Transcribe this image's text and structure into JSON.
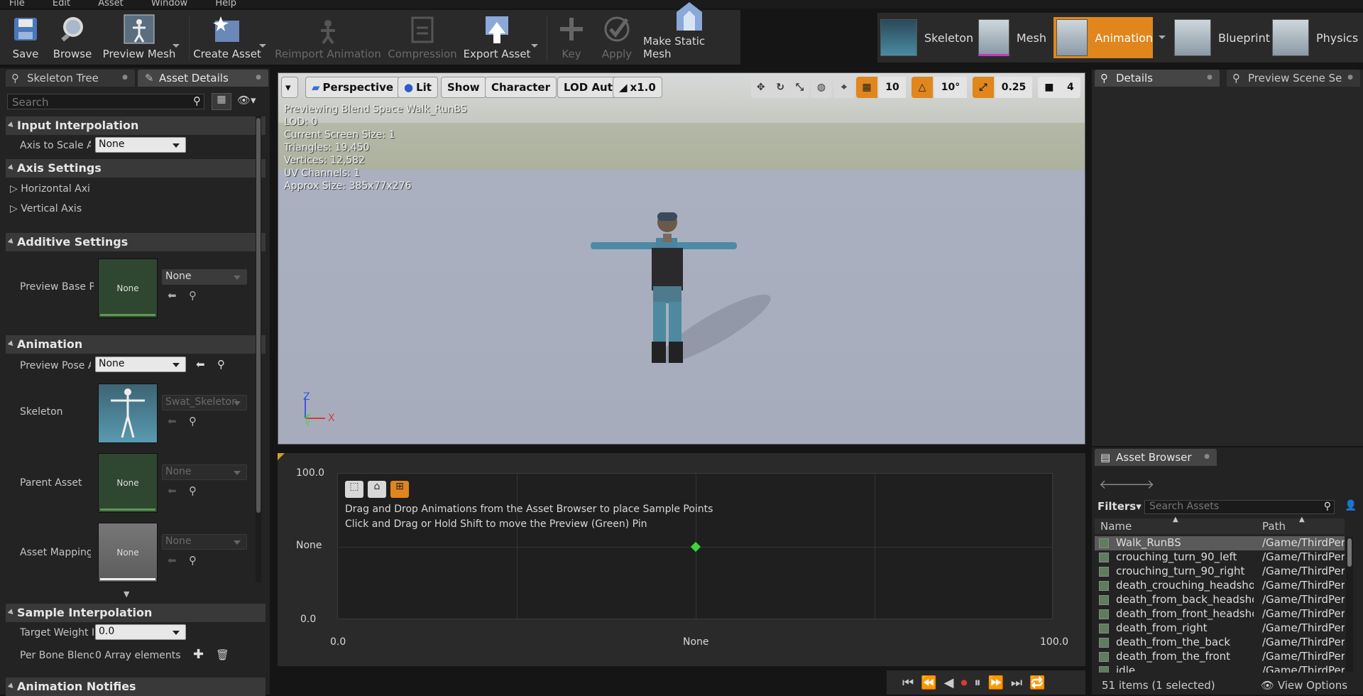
{
  "menu": [
    "File",
    "Edit",
    "Asset",
    "Window",
    "Help"
  ],
  "toolbar": {
    "save": "Save",
    "browse": "Browse",
    "preview_mesh": "Preview Mesh",
    "create_asset": "Create Asset",
    "reimport": "Reimport Animation",
    "compression": "Compression",
    "export_asset": "Export Asset",
    "key": "Key",
    "apply": "Apply",
    "make_static_mesh": "Make Static Mesh"
  },
  "modes": [
    "Skeleton",
    "Mesh",
    "Animation",
    "Blueprint",
    "Physics"
  ],
  "left_panel": {
    "tabs": [
      "Skeleton Tree",
      "Asset Details"
    ],
    "search_placeholder": "Search",
    "sections": {
      "input_interpolation": "Input Interpolation",
      "axis_settings": "Axis Settings",
      "additive_settings": "Additive Settings",
      "animation": "Animation",
      "sample_interpolation": "Sample Interpolation",
      "animation_notifies": "Animation Notifies"
    },
    "axis_to_scale_label": "Axis to Scale A",
    "axis_to_scale_value": "None",
    "horizontal_axis": "Horizontal Axis",
    "vertical_axis": "Vertical Axis",
    "preview_base_label": "Preview Base P",
    "preview_base_thumb": "None",
    "preview_base_value": "None",
    "preview_pose_label": "Preview Pose A",
    "preview_pose_value": "None",
    "skeleton_label": "Skeleton",
    "skeleton_value": "Swat_Skeleton",
    "parent_asset_label": "Parent Asset",
    "parent_asset_thumb": "None",
    "parent_asset_value": "None",
    "asset_mapping_label": "Asset Mapping",
    "asset_mapping_thumb": "None",
    "asset_mapping_value": "None",
    "target_weight_label": "Target Weight Ir",
    "target_weight_value": "0.0",
    "per_bone_label": "Per Bone Blend",
    "per_bone_value": "0 Array elements"
  },
  "viewport": {
    "perspective": "Perspective",
    "lit": "Lit",
    "show": "Show",
    "character": "Character",
    "lod": "LOD Auto",
    "speed": "x1.0",
    "grid_snap": "10",
    "rot_snap": "10°",
    "scale_snap": "0.25",
    "cam_speed": "4",
    "stats": [
      "Previewing Blend Space Walk_RunBS",
      "LOD: 0",
      "Current Screen Size: 1",
      "Triangles: 19,450",
      "Vertices: 12,582",
      "UV Channels: 1",
      "Approx Size: 385x77x276"
    ],
    "axis_z": "Z",
    "axis_x": "X",
    "axis_y": "Y"
  },
  "blendspace": {
    "hint1": "Drag and Drop Animations from the Asset Browser to place Sample Points",
    "hint2": "Click and Drag or Hold Shift to move the Preview (Green) Pin",
    "y_max": "100.0",
    "y_mid": "None",
    "y_min": "0.0",
    "x_min": "0.0",
    "x_mid": "None",
    "x_max": "100.0"
  },
  "right_panel": {
    "tabs": [
      "Details",
      "Preview Scene Se"
    ]
  },
  "asset_browser": {
    "tab": "Asset Browser",
    "filters": "Filters",
    "search_placeholder": "Search Assets",
    "col_name": "Name",
    "col_path": "Path",
    "rows": [
      {
        "name": "Walk_RunBS",
        "path": "/Game/ThirdPer"
      },
      {
        "name": "crouching_turn_90_left",
        "path": "/Game/ThirdPer"
      },
      {
        "name": "crouching_turn_90_right",
        "path": "/Game/ThirdPer"
      },
      {
        "name": "death_crouching_headshot_",
        "path": "/Game/ThirdPer"
      },
      {
        "name": "death_from_back_headshot",
        "path": "/Game/ThirdPer"
      },
      {
        "name": "death_from_front_headshot",
        "path": "/Game/ThirdPer"
      },
      {
        "name": "death_from_right",
        "path": "/Game/ThirdPer"
      },
      {
        "name": "death_from_the_back",
        "path": "/Game/ThirdPer"
      },
      {
        "name": "death_from_the_front",
        "path": "/Game/ThirdPer"
      },
      {
        "name": "idle",
        "path": "/Game/ThirdPer"
      }
    ],
    "status": "51 items (1 selected)",
    "view_options": "View Options"
  }
}
